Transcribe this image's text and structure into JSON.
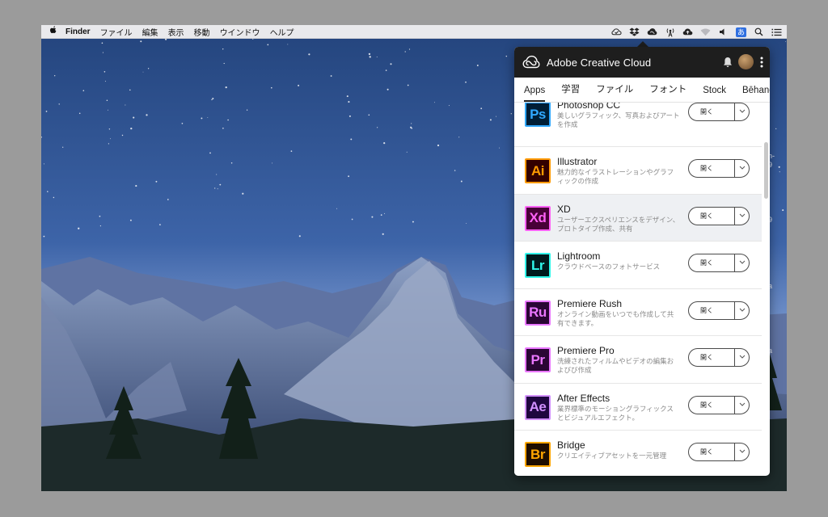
{
  "menubar": {
    "apple_icon": "apple-logo-icon",
    "items": [
      "Finder",
      "ファイル",
      "編集",
      "表示",
      "移動",
      "ウインドウ",
      "ヘルプ"
    ],
    "tray_icons": [
      "cloud-check-icon",
      "dropbox-icon",
      "creative-cloud-icon",
      "antenna-icon",
      "cloud-upload-icon",
      "wifi-icon",
      "volume-icon",
      "input-method-icon",
      "search-icon",
      "list-icon"
    ],
    "ime_label": "あ"
  },
  "desktop": {
    "edge_fragments": [
      "n-",
      "9",
      "9",
      "a",
      "a"
    ]
  },
  "panel": {
    "title": "Adobe Creative Cloud",
    "tabs": [
      "Apps",
      "学習",
      "ファイル",
      "フォント",
      "Stock",
      "Bēhance"
    ],
    "active_tab": "Apps",
    "apps": [
      {
        "abbr": "Ps",
        "name": "Photoshop CC",
        "desc": "美しいグラフィック、写真およびアートを作成",
        "button": "開く",
        "bg": "#001e36",
        "fg": "#31a8ff"
      },
      {
        "abbr": "Ai",
        "name": "Illustrator",
        "desc": "魅力的なイラストレーションやグラフィックの作成",
        "button": "開く",
        "bg": "#330000",
        "fg": "#ff9a00"
      },
      {
        "abbr": "Xd",
        "name": "XD",
        "desc": "ユーザーエクスペリエンスをデザイン、プロトタイプ作成、共有",
        "button": "開く",
        "bg": "#470137",
        "fg": "#ff61f6"
      },
      {
        "abbr": "Lr",
        "name": "Lightroom",
        "desc": "クラウドベースのフォトサービス",
        "button": "開く",
        "bg": "#001a1d",
        "fg": "#31f7ea"
      },
      {
        "abbr": "Ru",
        "name": "Premiere Rush",
        "desc": "オンライン動画をいつでも作成して共有できます。",
        "button": "開く",
        "bg": "#2a0634",
        "fg": "#ea77ff"
      },
      {
        "abbr": "Pr",
        "name": "Premiere Pro",
        "desc": "洗練されたフィルムやビデオの編集およびび作成",
        "button": "開く",
        "bg": "#2a0634",
        "fg": "#ea77ff"
      },
      {
        "abbr": "Ae",
        "name": "After Effects",
        "desc": "業界標準のモーショングラフィックスとビジュアルエフェクト。",
        "button": "開く",
        "bg": "#1f0740",
        "fg": "#d291ff"
      },
      {
        "abbr": "Br",
        "name": "Bridge",
        "desc": "クリエイティブアセットを一元管理",
        "button": "開く",
        "bg": "#1e0d00",
        "fg": "#ffa500"
      }
    ],
    "hovered_row": 2
  }
}
